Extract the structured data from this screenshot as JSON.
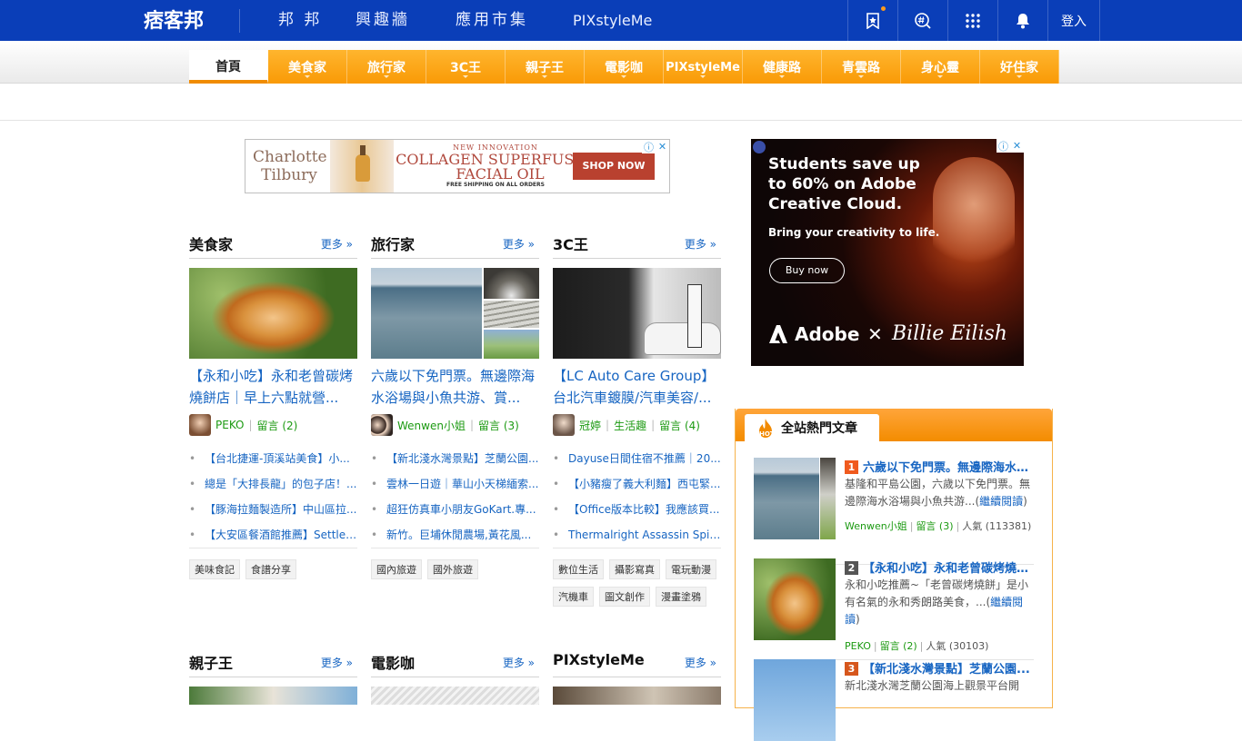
{
  "site": {
    "logo_text": "痞客邦",
    "top_nav": [
      "邦 邦",
      "興趣牆",
      "應用市集",
      "PIXstyleMe"
    ],
    "login_label": "登入",
    "icons": [
      "bookmark-star-icon",
      "hashtag-search-icon",
      "apps-grid-icon",
      "bell-icon"
    ]
  },
  "categories": [
    "首頁",
    "美食家",
    "旅行家",
    "3C王",
    "親子王",
    "電影咖",
    "PIXstyleMe",
    "健康路",
    "青雲路",
    "身心靈",
    "好住家"
  ],
  "ads": {
    "banner": {
      "brand": "Charlotte Tilbury",
      "line1": "NEW INNOVATION",
      "line2": "COLLAGEN SUPERFUSION FACIAL OIL",
      "line3": "FREE SHIPPING ON ALL ORDERS",
      "cta": "SHOP NOW"
    },
    "side": {
      "headline": "Students save up to 60% on Adobe Creative Cloud.",
      "sub": "Bring your creativity to life.",
      "cta": "Buy now",
      "brand1": "Adobe",
      "cross": "✕",
      "brand2": "Billie Eilish"
    }
  },
  "more_label": "更多 »",
  "sections": [
    {
      "title": "美食家",
      "post_title": "【永和小吃】永和老曾碳烤燒餅店｜早上六點就營...",
      "author": "PEKO",
      "comments": "留言 (2)",
      "links": [
        "【台北捷運-頂溪站美食】小...",
        "總是「大排長龍」的包子店！...",
        "【豚海拉麵製造所】中山區拉...",
        "【大安區餐酒館推薦】Settle ..."
      ],
      "tags": [
        "美味食記",
        "食譜分享"
      ]
    },
    {
      "title": "旅行家",
      "post_title": "六歲以下免門票。無邊際海水浴場與小魚共游、賞...",
      "author": "Wenwen小姐",
      "comments": "留言 (3)",
      "links": [
        "【新北淺水灣景點】芝蘭公園...",
        "雲林一日遊｜華山小天梯緬索...",
        "超狂仿真車小朋友GoKart.專...",
        "新竹。巨埔休閒農場,黃花風..."
      ],
      "tags": [
        "國內旅遊",
        "國外旅遊"
      ]
    },
    {
      "title": "3C王",
      "post_title": "【LC Auto Care Group】台北汽車鍍膜/汽車美容/...",
      "author": "冠婷",
      "category": "生活趣",
      "comments": "留言 (4)",
      "links": [
        "Dayuse日間住宿不推薦｜20...",
        "【小豬瘦了義大利麵】西屯緊...",
        "【Office版本比較】我應該買...",
        "Thermalright Assassin Spirit ..."
      ],
      "tags": [
        "數位生活",
        "攝影寫真",
        "電玩動漫",
        "汽機車",
        "圖文創作",
        "漫畫塗鴉"
      ]
    }
  ],
  "sections_row2": [
    "親子王",
    "電影咖",
    "PIXstyleMe"
  ],
  "hot": {
    "title": "全站熱門文章",
    "read_more": "繼續閱讀",
    "items": [
      {
        "rank": "1",
        "rank_color": "#f05a1e",
        "title": "六歲以下免門票。無邊際海水浴場與小魚共游、賞...",
        "desc": "基隆和平島公園，六歲以下免門票。無邊際海水浴場與小魚共游...",
        "author": "Wenwen小姐",
        "comments": "留言 (3)",
        "popularity": "人氣 (113381)"
      },
      {
        "rank": "2",
        "rank_color": "#555555",
        "title": "【永和小吃】永和老曾碳烤燒餅店...",
        "desc": "永和小吃推薦~「老曾碳烤燒餅」是小有名氣的永和秀朗路美食，...",
        "author": "PEKO",
        "comments": "留言 (2)",
        "popularity": "人氣 (30103)"
      },
      {
        "rank": "3",
        "rank_color": "#d6561c",
        "title": "【新北淺水灣景點】芝蘭公園...",
        "desc": "新北淺水灣芝蘭公園海上觀景平台開"
      }
    ]
  }
}
